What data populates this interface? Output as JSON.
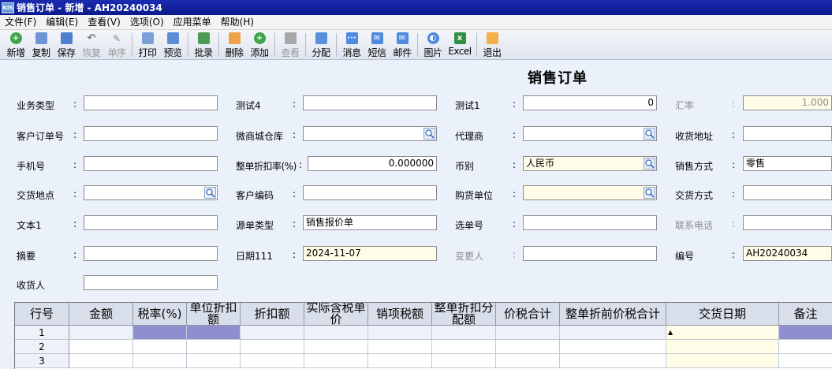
{
  "window": {
    "logo": "KIS",
    "title": "销售订单 - 新增 - AH20240034"
  },
  "menu": [
    "文件(F)",
    "编辑(E)",
    "查看(V)",
    "选项(O)",
    "应用菜单",
    "帮助(H)"
  ],
  "toolbar": {
    "new": "新增",
    "copy": "复制",
    "save": "保存",
    "restore": "恢复",
    "source": "单序",
    "print": "打印",
    "preview": "预览",
    "batch": "批录",
    "delete": "删除",
    "add": "添加",
    "view": "查看",
    "split": "分配",
    "message": "消息",
    "sms": "短信",
    "mail": "邮件",
    "image": "图片",
    "excel": "Excel",
    "exit": "退出"
  },
  "colors": {
    "titlebar": "#0a1a8c",
    "form_bg": "#ebf1fb",
    "highlight_cell": "#8f8fcf",
    "yellow_field": "#fffde7"
  },
  "form": {
    "title": "销售订单",
    "fields": {
      "biz_type": {
        "label": "业务类型",
        "value": ""
      },
      "test4": {
        "label": "测试4",
        "value": ""
      },
      "test1": {
        "label": "测试1",
        "value": "0"
      },
      "exchange_rate": {
        "label": "汇率",
        "value": "1.000"
      },
      "customer_po": {
        "label": "客户订单号",
        "value": ""
      },
      "mall_warehouse": {
        "label": "微商城仓库",
        "value": ""
      },
      "agent": {
        "label": "代理商",
        "value": ""
      },
      "ship_address": {
        "label": "收货地址",
        "value": ""
      },
      "mobile": {
        "label": "手机号",
        "value": ""
      },
      "discount_rate": {
        "label": "整单折扣率(%)",
        "value": "0.000000"
      },
      "currency": {
        "label": "币别",
        "value": "人民币"
      },
      "sales_method": {
        "label": "销售方式",
        "value": "零售"
      },
      "delivery_place": {
        "label": "交货地点",
        "value": ""
      },
      "customer_code": {
        "label": "客户编码",
        "value": ""
      },
      "purchase_unit": {
        "label": "购货单位",
        "value": ""
      },
      "delivery_method": {
        "label": "交货方式",
        "value": ""
      },
      "text1": {
        "label": "文本1",
        "value": ""
      },
      "source_type": {
        "label": "源单类型",
        "value": "销售报价单"
      },
      "select_no": {
        "label": "选单号",
        "value": ""
      },
      "contact_phone": {
        "label": "联系电话",
        "value": ""
      },
      "summary": {
        "label": "摘要",
        "value": ""
      },
      "date111": {
        "label": "日期111",
        "value": "2024-11-07"
      },
      "changer": {
        "label": "变更人",
        "value": ""
      },
      "doc_no": {
        "label": "编号",
        "value": "AH20240034"
      },
      "receiver": {
        "label": "收货人",
        "value": ""
      }
    },
    "colon": ":"
  },
  "grid": {
    "columns": [
      "行号",
      "金额",
      "税率(%)",
      "单位折扣额",
      "折扣额",
      "实际含税单价",
      "销项税额",
      "整单折扣分配额",
      "价税合计",
      "整单折前价税合计",
      "交货日期",
      "备注"
    ],
    "rows": [
      "1",
      "2",
      "3"
    ]
  }
}
